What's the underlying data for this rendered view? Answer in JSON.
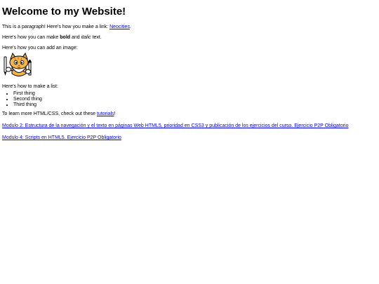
{
  "heading": "Welcome to my Website!",
  "para_link": {
    "before": "This is a paragraph! Here's how you make a link: ",
    "link_text": "Neocities",
    "after": "."
  },
  "para_format": {
    "before": "Here's how you can make ",
    "bold": "bold",
    "middle": " and ",
    "italic": "italic",
    "after": " text."
  },
  "para_image": "Here's how you can add an image:",
  "image_icon": "neocities-cat-mascot-icon",
  "para_list": "Here's how to make a list:",
  "list_items": [
    "First thing",
    "Second thing",
    "Third thing"
  ],
  "para_learn": {
    "before": "To learn more HTML/CSS, check out these ",
    "link_text": "tutorials",
    "after": "!"
  },
  "module_links": [
    "Modulo 2: Estructura de la navegación y el texto en páginas Web HTML5, prioridad en CSS3 y publicación de los ejercicios del curso. Ejercicio P2P Obligatorio",
    "Modulo 4: Scripts en HTML5. Ejercicio P2P Obligatorio"
  ],
  "colors": {
    "link": "#0000ee",
    "text": "#000000",
    "background": "#ffffff"
  }
}
